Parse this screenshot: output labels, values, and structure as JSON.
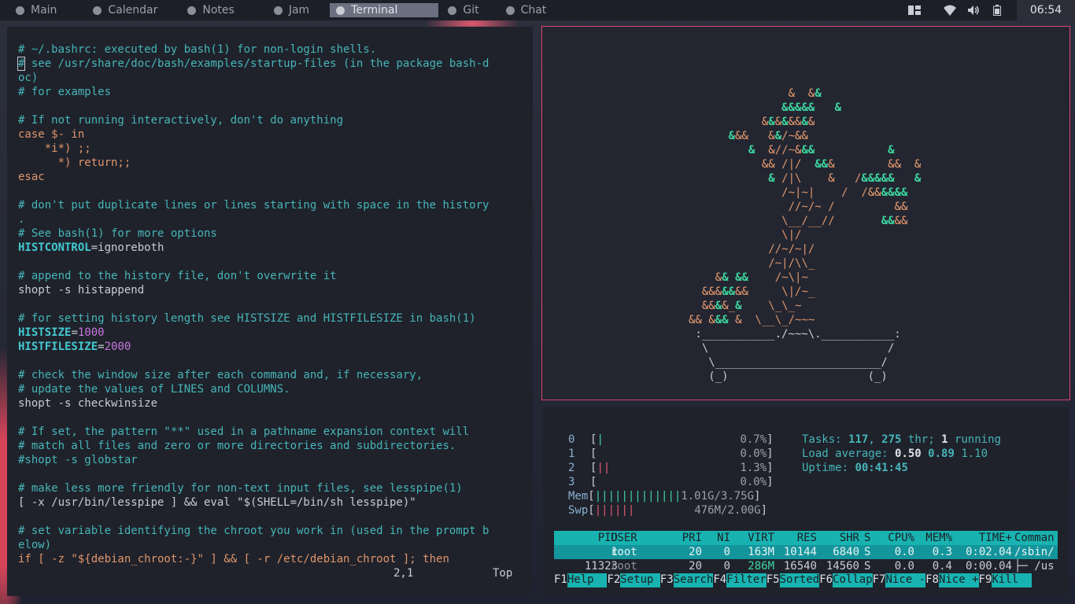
{
  "topbar": {
    "workspaces": [
      {
        "label": "Main"
      },
      {
        "label": "Calendar"
      },
      {
        "label": "Notes"
      },
      {
        "label": "Jam"
      },
      {
        "label": "Terminal"
      },
      {
        "label": "Git"
      },
      {
        "label": "Chat"
      }
    ],
    "active_workspace": "Terminal",
    "clock": "06:54"
  },
  "vim": {
    "lines": [
      "# ~/.bashrc: executed by bash(1) for non-login shells.",
      "# see /usr/share/doc/bash/examples/startup-files (in the package bash-d",
      "oc)",
      "# for examples",
      "",
      "# If not running interactively, don't do anything",
      "case $- in",
      "    *i*) ;;",
      "      *) return;;",
      "esac",
      "",
      "# don't put duplicate lines or lines starting with space in the history",
      ".",
      "# See bash(1) for more options",
      "HISTCONTROL=ignoreboth",
      "",
      "# append to the history file, don't overwrite it",
      "shopt -s histappend",
      "",
      "# for setting history length see HISTSIZE and HISTFILESIZE in bash(1)",
      "HISTSIZE=1000",
      "HISTFILESIZE=2000",
      "",
      "# check the window size after each command and, if necessary,",
      "# update the values of LINES and COLUMNS.",
      "shopt -s checkwinsize",
      "",
      "# If set, the pattern \"**\" used in a pathname expansion context will",
      "# match all files and zero or more directories and subdirectories.",
      "#shopt -s globstar",
      "",
      "# make less more friendly for non-text input files, see lesspipe(1)",
      "[ -x /usr/bin/lesspipe ] && eval \"$(SHELL=/bin/sh lesspipe)\"",
      "",
      "# set variable identifying the chroot you work in (used in the prompt b",
      "elow)",
      "if [ -z \"${debian_chroot:-}\" ] && [ -r /etc/debian_chroot ]; then"
    ],
    "cursor_position": "2,1",
    "scroll_position": "Top"
  },
  "bonsai": {
    "lines": [
      "               &  &&",
      "              &&&&&   &",
      "           &&&&&&&&",
      "      &&&   &&/~&&",
      "         &  &//~&&&           &",
      "           && /|/  &&&        &&  &",
      "            & /|\\    &   /&&&&&   &",
      "              /~|~|    /  /&&&&&&",
      "               //~/~ /         &&",
      "              \\__/__//       &&&&",
      "              \\|/",
      "            //~/~|/",
      "            /~|/\\\\_",
      "    && &&    /~\\|~",
      "  &&&&&&&     \\|/~_",
      "  &&&&_&    \\_\\_~",
      "&& &&& &  \\__\\_/~~~",
      " :___________./~~~\\.___________:",
      "  \\                           /",
      "   \\_________________________/",
      "   (_)                     (_)"
    ]
  },
  "htop": {
    "cpus": [
      {
        "id": "0",
        "bar": "|",
        "pct": "0.7%"
      },
      {
        "id": "1",
        "bar": "",
        "pct": "0.0%"
      },
      {
        "id": "2",
        "bar": "||",
        "pct": "1.3%"
      },
      {
        "id": "3",
        "bar": "",
        "pct": "0.0%"
      }
    ],
    "mem": {
      "label": "Mem",
      "bar": "|||||||||||||",
      "value": "1.01G/3.75G"
    },
    "swp": {
      "label": "Swp",
      "bar": "||||||",
      "value": "476M/2.00G"
    },
    "tasks_label": "Tasks:",
    "tasks": "117",
    "threads": "275",
    "thr_label": "thr;",
    "running": "1",
    "running_label": "running",
    "load_label": "Load average:",
    "load1": "0.50",
    "load5": "0.89",
    "load15": "1.10",
    "uptime_label": "Uptime:",
    "uptime": "00:41:45",
    "columns": [
      "PID",
      "USER",
      "PRI",
      "NI",
      "VIRT",
      "RES",
      "SHR",
      "S",
      "CPU%",
      "MEM%",
      "TIME+",
      "Comman"
    ],
    "processes": [
      {
        "pid": "1",
        "user": "root",
        "pri": "20",
        "ni": "0",
        "virt": "163M",
        "res": "10144",
        "shr": "6840",
        "s": "S",
        "cpu": "0.0",
        "mem": "0.3",
        "time": "0:02.04",
        "cmd": "/sbin/"
      },
      {
        "pid": "11323",
        "user": "root",
        "pri": "20",
        "ni": "0",
        "virt": "286M",
        "res": "16540",
        "shr": "14560",
        "s": "S",
        "cpu": "0.0",
        "mem": "0.4",
        "time": "0:00.04",
        "cmd": "├─ /us"
      }
    ],
    "fkeys": [
      {
        "num": "F1",
        "label": "Help  "
      },
      {
        "num": "F2",
        "label": "Setup "
      },
      {
        "num": "F3",
        "label": "Search"
      },
      {
        "num": "F4",
        "label": "Filter"
      },
      {
        "num": "F5",
        "label": "Sorted"
      },
      {
        "num": "F6",
        "label": "Collap"
      },
      {
        "num": "F7",
        "label": "Nice -"
      },
      {
        "num": "F8",
        "label": "Nice +"
      },
      {
        "num": "F9",
        "label": "Kill  "
      }
    ]
  }
}
